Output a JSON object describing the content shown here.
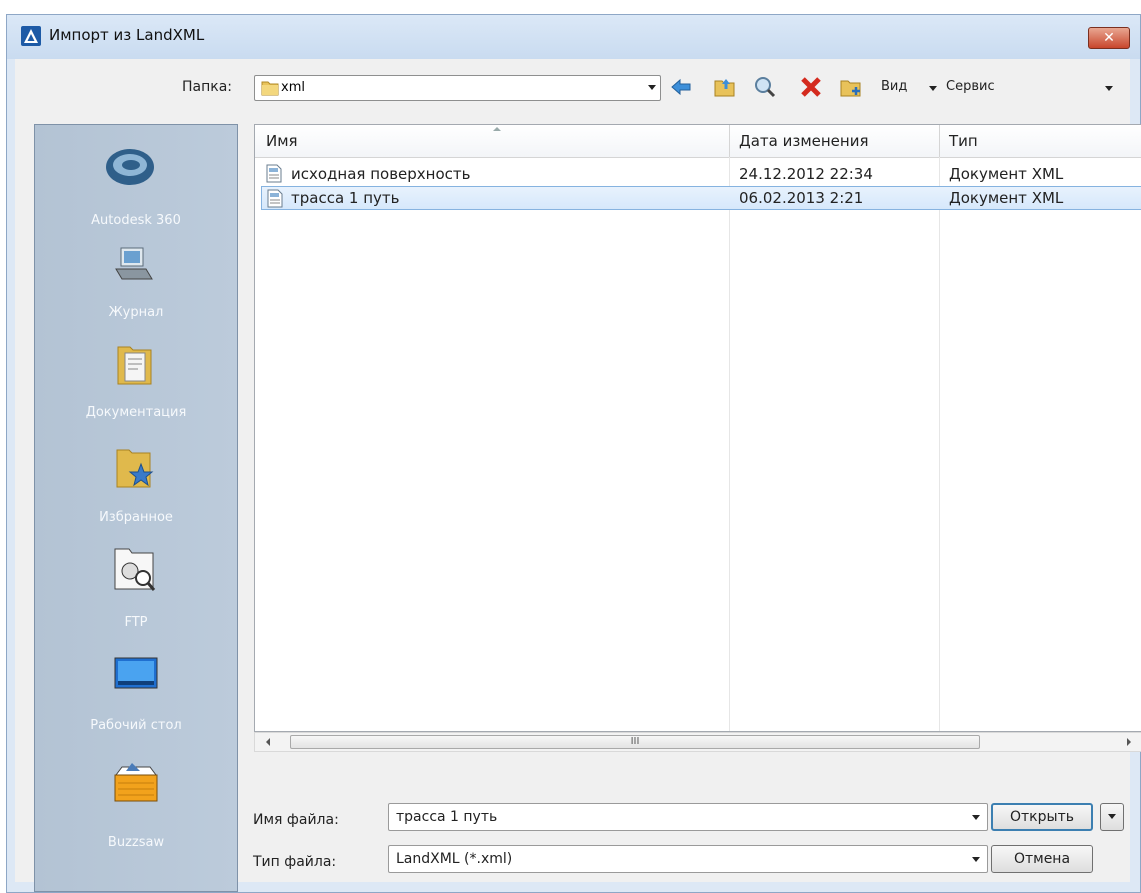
{
  "window": {
    "title": "Импорт из LandXML",
    "close_label": "✕"
  },
  "folder": {
    "label": "Папка:",
    "current": "xml"
  },
  "toolbar": {
    "view_label": "Вид",
    "tools_label": "Сервис"
  },
  "places": [
    {
      "label": "Autodesk 360",
      "icon": "autodesk-360-icon"
    },
    {
      "label": "Журнал",
      "icon": "history-icon"
    },
    {
      "label": "Документация",
      "icon": "documents-icon"
    },
    {
      "label": "Избранное",
      "icon": "favorites-icon"
    },
    {
      "label": "FTP",
      "icon": "ftp-icon"
    },
    {
      "label": "Рабочий стол",
      "icon": "desktop-icon"
    },
    {
      "label": "Buzzsaw",
      "icon": "buzzsaw-icon"
    }
  ],
  "columns": {
    "name": "Имя",
    "date": "Дата изменения",
    "type": "Тип"
  },
  "files": [
    {
      "name": "исходная поверхность",
      "date": "24.12.2012 22:34",
      "type": "Документ XML",
      "selected": false
    },
    {
      "name": "трасса 1 путь",
      "date": "06.02.2013 2:21",
      "type": "Документ XML",
      "selected": true
    }
  ],
  "scrollbar": {
    "grip": "III"
  },
  "filename": {
    "label": "Имя файла:",
    "value": "трасса 1 путь"
  },
  "filetype": {
    "label": "Тип файла:",
    "value": "LandXML (*.xml)"
  },
  "buttons": {
    "open": "Открыть",
    "cancel": "Отмена"
  }
}
